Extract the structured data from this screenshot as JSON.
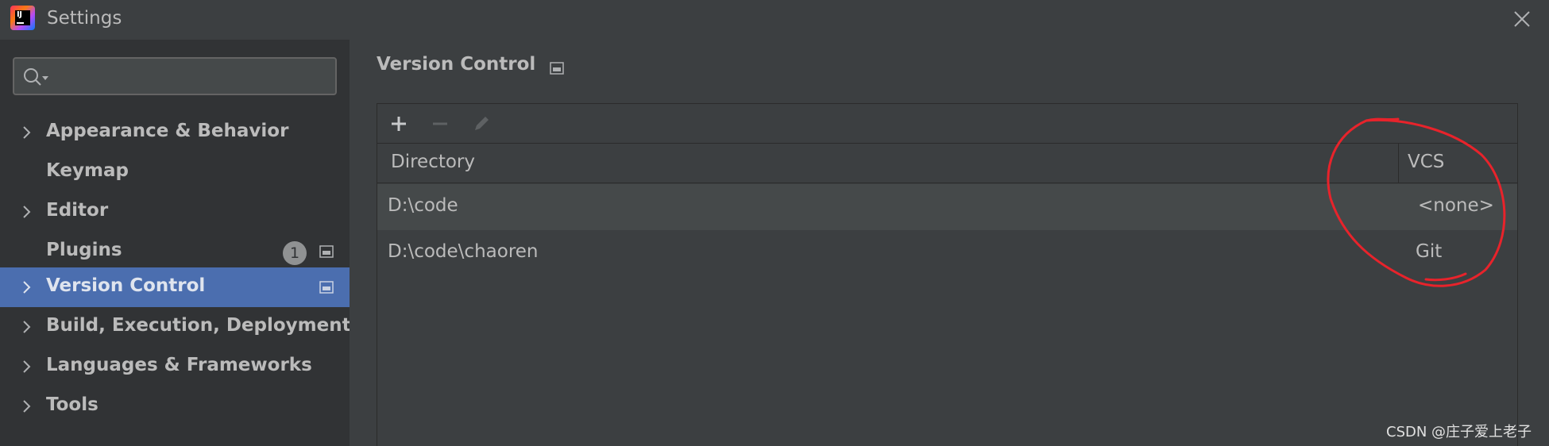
{
  "window": {
    "title": "Settings",
    "app_logo_text": "IJ"
  },
  "search": {
    "placeholder": "",
    "value": ""
  },
  "sidebar": {
    "items": [
      {
        "label": "Appearance & Behavior",
        "expandable": true
      },
      {
        "label": "Keymap",
        "expandable": false
      },
      {
        "label": "Editor",
        "expandable": true
      },
      {
        "label": "Plugins",
        "expandable": false,
        "badge": "1"
      },
      {
        "label": "Version Control",
        "expandable": true,
        "selected": true
      },
      {
        "label": "Build, Execution, Deployment",
        "expandable": true
      },
      {
        "label": "Languages & Frameworks",
        "expandable": true
      },
      {
        "label": "Tools",
        "expandable": true
      }
    ]
  },
  "main": {
    "title": "Version Control",
    "toolbar": {
      "add": "add-icon",
      "remove": "remove-icon",
      "edit": "edit-icon"
    },
    "table": {
      "columns": [
        "Directory",
        "VCS"
      ],
      "rows": [
        {
          "directory": "D:\\code",
          "vcs": "<none>"
        },
        {
          "directory": "D:\\code\\chaoren",
          "vcs": "Git"
        }
      ]
    }
  },
  "watermark": "CSDN @庄子爱上老子",
  "colors": {
    "background": "#3c3f41",
    "sidebar": "#313335",
    "selection": "#4b6eaf",
    "annotation": "#e8232b"
  }
}
